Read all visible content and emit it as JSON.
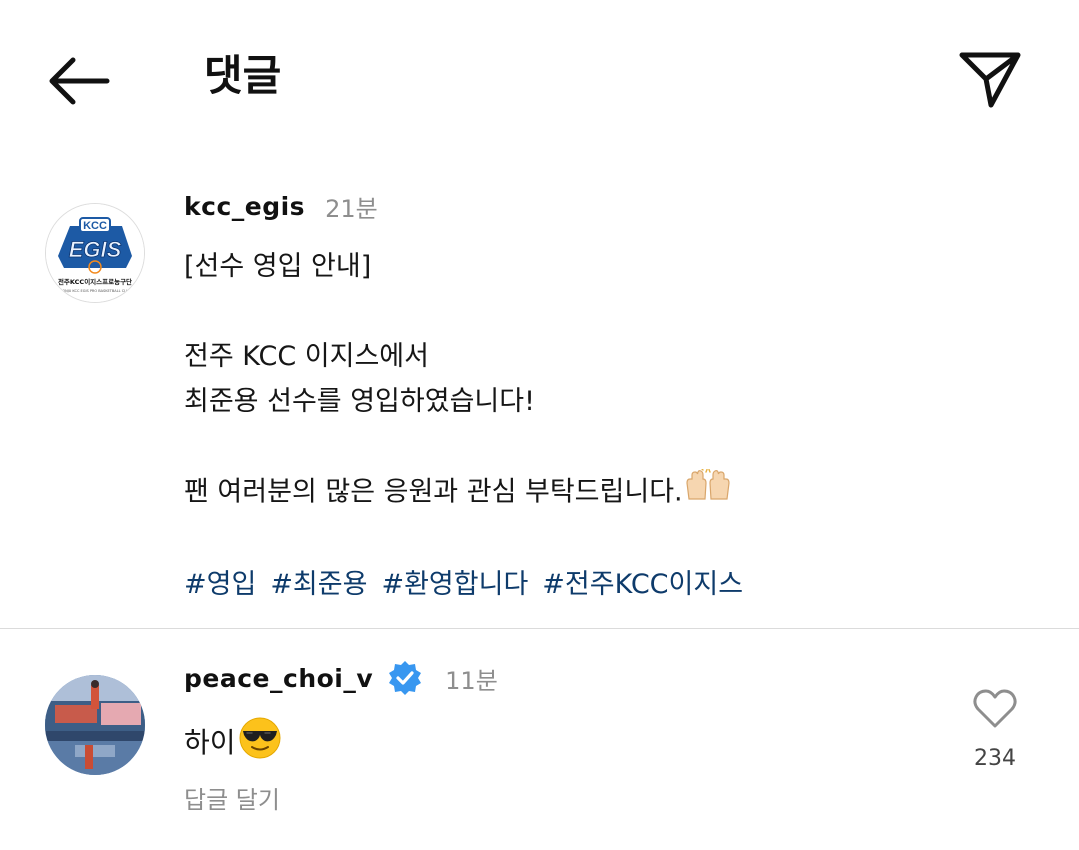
{
  "header": {
    "title": "댓글",
    "back_icon": "back-arrow-icon",
    "share_icon": "paper-plane-icon"
  },
  "caption": {
    "username": "kcc_egis",
    "time": "21분",
    "avatar_logo_text": "KCC EGIS",
    "avatar_subtext": "전주KCC이지스프로농구단",
    "lines": [
      "[선수 영입 안내]",
      "",
      "전주 KCC 이지스에서",
      "최준용 선수를 영입하였습니다!",
      "",
      "팬 여러분의 많은 응원과 관심 부탁드립니다."
    ],
    "hashtags": [
      "#영입",
      "#최준용",
      "#환영합니다",
      "#전주KCC이지스"
    ],
    "hashtag_color": "#0e3b6b"
  },
  "comment": {
    "username": "peace_choi_v",
    "verified_icon": "verified-badge-icon",
    "verified_color": "#3897f0",
    "time": "11분",
    "text": "하이",
    "emoji": "smiling-face-with-sunglasses-icon",
    "reply_label": "답글 달기",
    "like_icon": "heart-outline-icon",
    "like_count": "234"
  }
}
